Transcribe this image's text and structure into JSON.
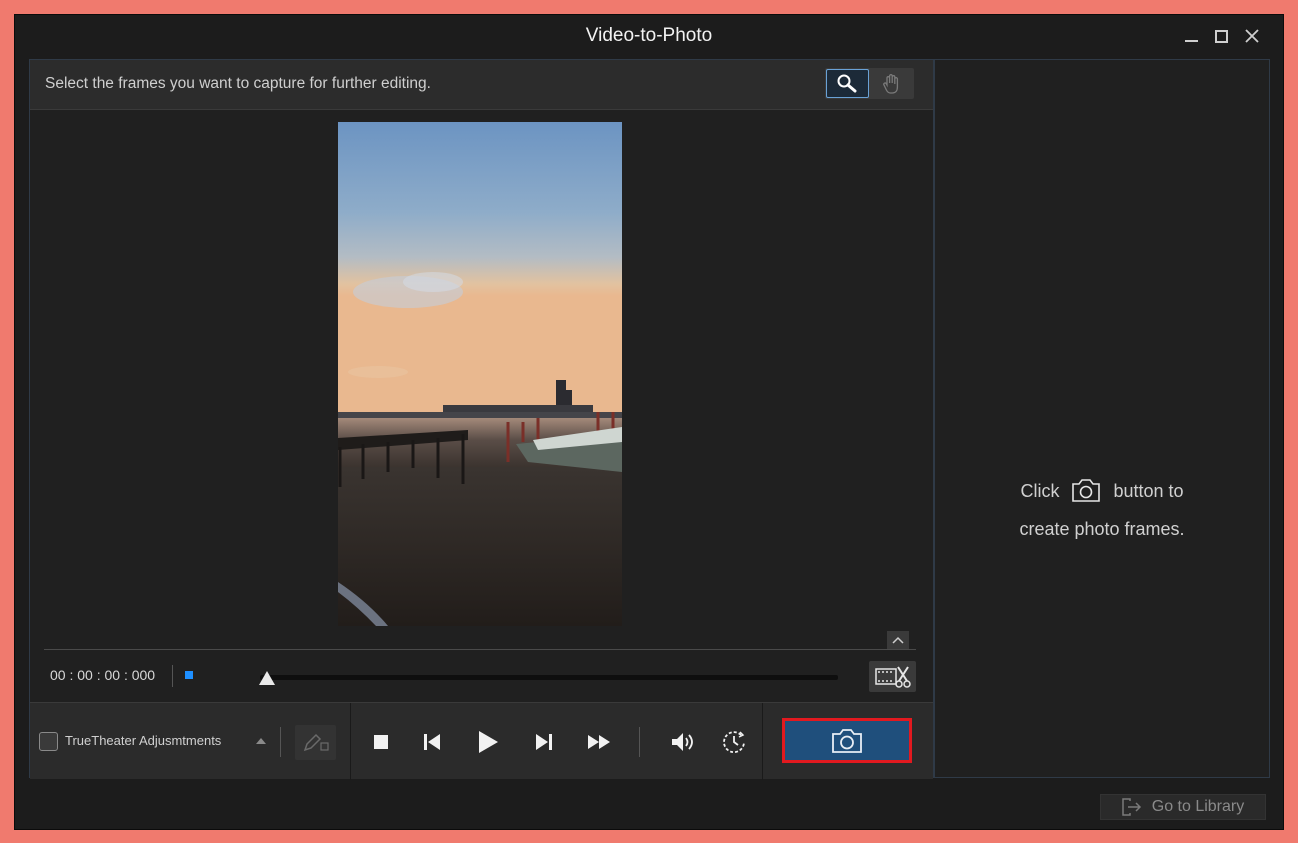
{
  "window": {
    "title": "Video-to-Photo",
    "controls": [
      "minimize-icon",
      "maximize-icon",
      "close-icon"
    ]
  },
  "editor": {
    "instruction": "Select the frames you want to capture for further editing.",
    "tools": [
      {
        "name": "zoom-tool",
        "icon": "magnifier-icon",
        "active": true
      },
      {
        "name": "pan-tool",
        "icon": "hand-icon",
        "active": false
      }
    ],
    "timecode": "00 : 00 : 00 : 000",
    "playhead_progress": 0.0
  },
  "controls": {
    "truetheater_label": "TrueTheater Adjusmtments",
    "truetheater_checked": false,
    "playback": [
      "stop-icon",
      "previous-frame-icon",
      "play-icon",
      "next-frame-icon",
      "fast-forward-icon",
      "volume-icon",
      "playback-speed-icon"
    ],
    "capture_icon": "camera-icon"
  },
  "right_panel": {
    "hint_prefix": "Click",
    "hint_suffix": "button to",
    "hint_line2": "create photo frames."
  },
  "footer": {
    "go_to_library": "Go to Library"
  },
  "colors": {
    "accent_blue": "#1f4f7c",
    "highlight_red": "#e2191f",
    "marker_blue": "#1e8fff",
    "background": "#1c1c1c"
  }
}
